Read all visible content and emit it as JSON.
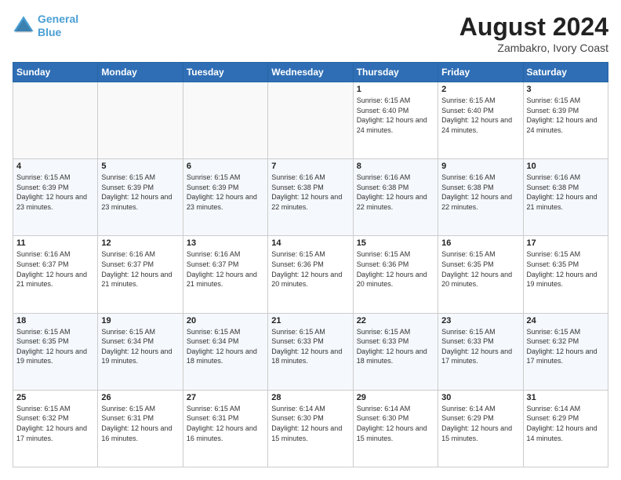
{
  "header": {
    "logo_line1": "General",
    "logo_line2": "Blue",
    "main_title": "August 2024",
    "subtitle": "Zambakro, Ivory Coast"
  },
  "weekdays": [
    "Sunday",
    "Monday",
    "Tuesday",
    "Wednesday",
    "Thursday",
    "Friday",
    "Saturday"
  ],
  "weeks": [
    [
      {
        "day": "",
        "info": ""
      },
      {
        "day": "",
        "info": ""
      },
      {
        "day": "",
        "info": ""
      },
      {
        "day": "",
        "info": ""
      },
      {
        "day": "1",
        "info": "Sunrise: 6:15 AM\nSunset: 6:40 PM\nDaylight: 12 hours\nand 24 minutes."
      },
      {
        "day": "2",
        "info": "Sunrise: 6:15 AM\nSunset: 6:40 PM\nDaylight: 12 hours\nand 24 minutes."
      },
      {
        "day": "3",
        "info": "Sunrise: 6:15 AM\nSunset: 6:39 PM\nDaylight: 12 hours\nand 24 minutes."
      }
    ],
    [
      {
        "day": "4",
        "info": "Sunrise: 6:15 AM\nSunset: 6:39 PM\nDaylight: 12 hours\nand 23 minutes."
      },
      {
        "day": "5",
        "info": "Sunrise: 6:15 AM\nSunset: 6:39 PM\nDaylight: 12 hours\nand 23 minutes."
      },
      {
        "day": "6",
        "info": "Sunrise: 6:15 AM\nSunset: 6:39 PM\nDaylight: 12 hours\nand 23 minutes."
      },
      {
        "day": "7",
        "info": "Sunrise: 6:16 AM\nSunset: 6:38 PM\nDaylight: 12 hours\nand 22 minutes."
      },
      {
        "day": "8",
        "info": "Sunrise: 6:16 AM\nSunset: 6:38 PM\nDaylight: 12 hours\nand 22 minutes."
      },
      {
        "day": "9",
        "info": "Sunrise: 6:16 AM\nSunset: 6:38 PM\nDaylight: 12 hours\nand 22 minutes."
      },
      {
        "day": "10",
        "info": "Sunrise: 6:16 AM\nSunset: 6:38 PM\nDaylight: 12 hours\nand 21 minutes."
      }
    ],
    [
      {
        "day": "11",
        "info": "Sunrise: 6:16 AM\nSunset: 6:37 PM\nDaylight: 12 hours\nand 21 minutes."
      },
      {
        "day": "12",
        "info": "Sunrise: 6:16 AM\nSunset: 6:37 PM\nDaylight: 12 hours\nand 21 minutes."
      },
      {
        "day": "13",
        "info": "Sunrise: 6:16 AM\nSunset: 6:37 PM\nDaylight: 12 hours\nand 21 minutes."
      },
      {
        "day": "14",
        "info": "Sunrise: 6:15 AM\nSunset: 6:36 PM\nDaylight: 12 hours\nand 20 minutes."
      },
      {
        "day": "15",
        "info": "Sunrise: 6:15 AM\nSunset: 6:36 PM\nDaylight: 12 hours\nand 20 minutes."
      },
      {
        "day": "16",
        "info": "Sunrise: 6:15 AM\nSunset: 6:35 PM\nDaylight: 12 hours\nand 20 minutes."
      },
      {
        "day": "17",
        "info": "Sunrise: 6:15 AM\nSunset: 6:35 PM\nDaylight: 12 hours\nand 19 minutes."
      }
    ],
    [
      {
        "day": "18",
        "info": "Sunrise: 6:15 AM\nSunset: 6:35 PM\nDaylight: 12 hours\nand 19 minutes."
      },
      {
        "day": "19",
        "info": "Sunrise: 6:15 AM\nSunset: 6:34 PM\nDaylight: 12 hours\nand 19 minutes."
      },
      {
        "day": "20",
        "info": "Sunrise: 6:15 AM\nSunset: 6:34 PM\nDaylight: 12 hours\nand 18 minutes."
      },
      {
        "day": "21",
        "info": "Sunrise: 6:15 AM\nSunset: 6:33 PM\nDaylight: 12 hours\nand 18 minutes."
      },
      {
        "day": "22",
        "info": "Sunrise: 6:15 AM\nSunset: 6:33 PM\nDaylight: 12 hours\nand 18 minutes."
      },
      {
        "day": "23",
        "info": "Sunrise: 6:15 AM\nSunset: 6:33 PM\nDaylight: 12 hours\nand 17 minutes."
      },
      {
        "day": "24",
        "info": "Sunrise: 6:15 AM\nSunset: 6:32 PM\nDaylight: 12 hours\nand 17 minutes."
      }
    ],
    [
      {
        "day": "25",
        "info": "Sunrise: 6:15 AM\nSunset: 6:32 PM\nDaylight: 12 hours\nand 17 minutes."
      },
      {
        "day": "26",
        "info": "Sunrise: 6:15 AM\nSunset: 6:31 PM\nDaylight: 12 hours\nand 16 minutes."
      },
      {
        "day": "27",
        "info": "Sunrise: 6:15 AM\nSunset: 6:31 PM\nDaylight: 12 hours\nand 16 minutes."
      },
      {
        "day": "28",
        "info": "Sunrise: 6:14 AM\nSunset: 6:30 PM\nDaylight: 12 hours\nand 15 minutes."
      },
      {
        "day": "29",
        "info": "Sunrise: 6:14 AM\nSunset: 6:30 PM\nDaylight: 12 hours\nand 15 minutes."
      },
      {
        "day": "30",
        "info": "Sunrise: 6:14 AM\nSunset: 6:29 PM\nDaylight: 12 hours\nand 15 minutes."
      },
      {
        "day": "31",
        "info": "Sunrise: 6:14 AM\nSunset: 6:29 PM\nDaylight: 12 hours\nand 14 minutes."
      }
    ]
  ]
}
